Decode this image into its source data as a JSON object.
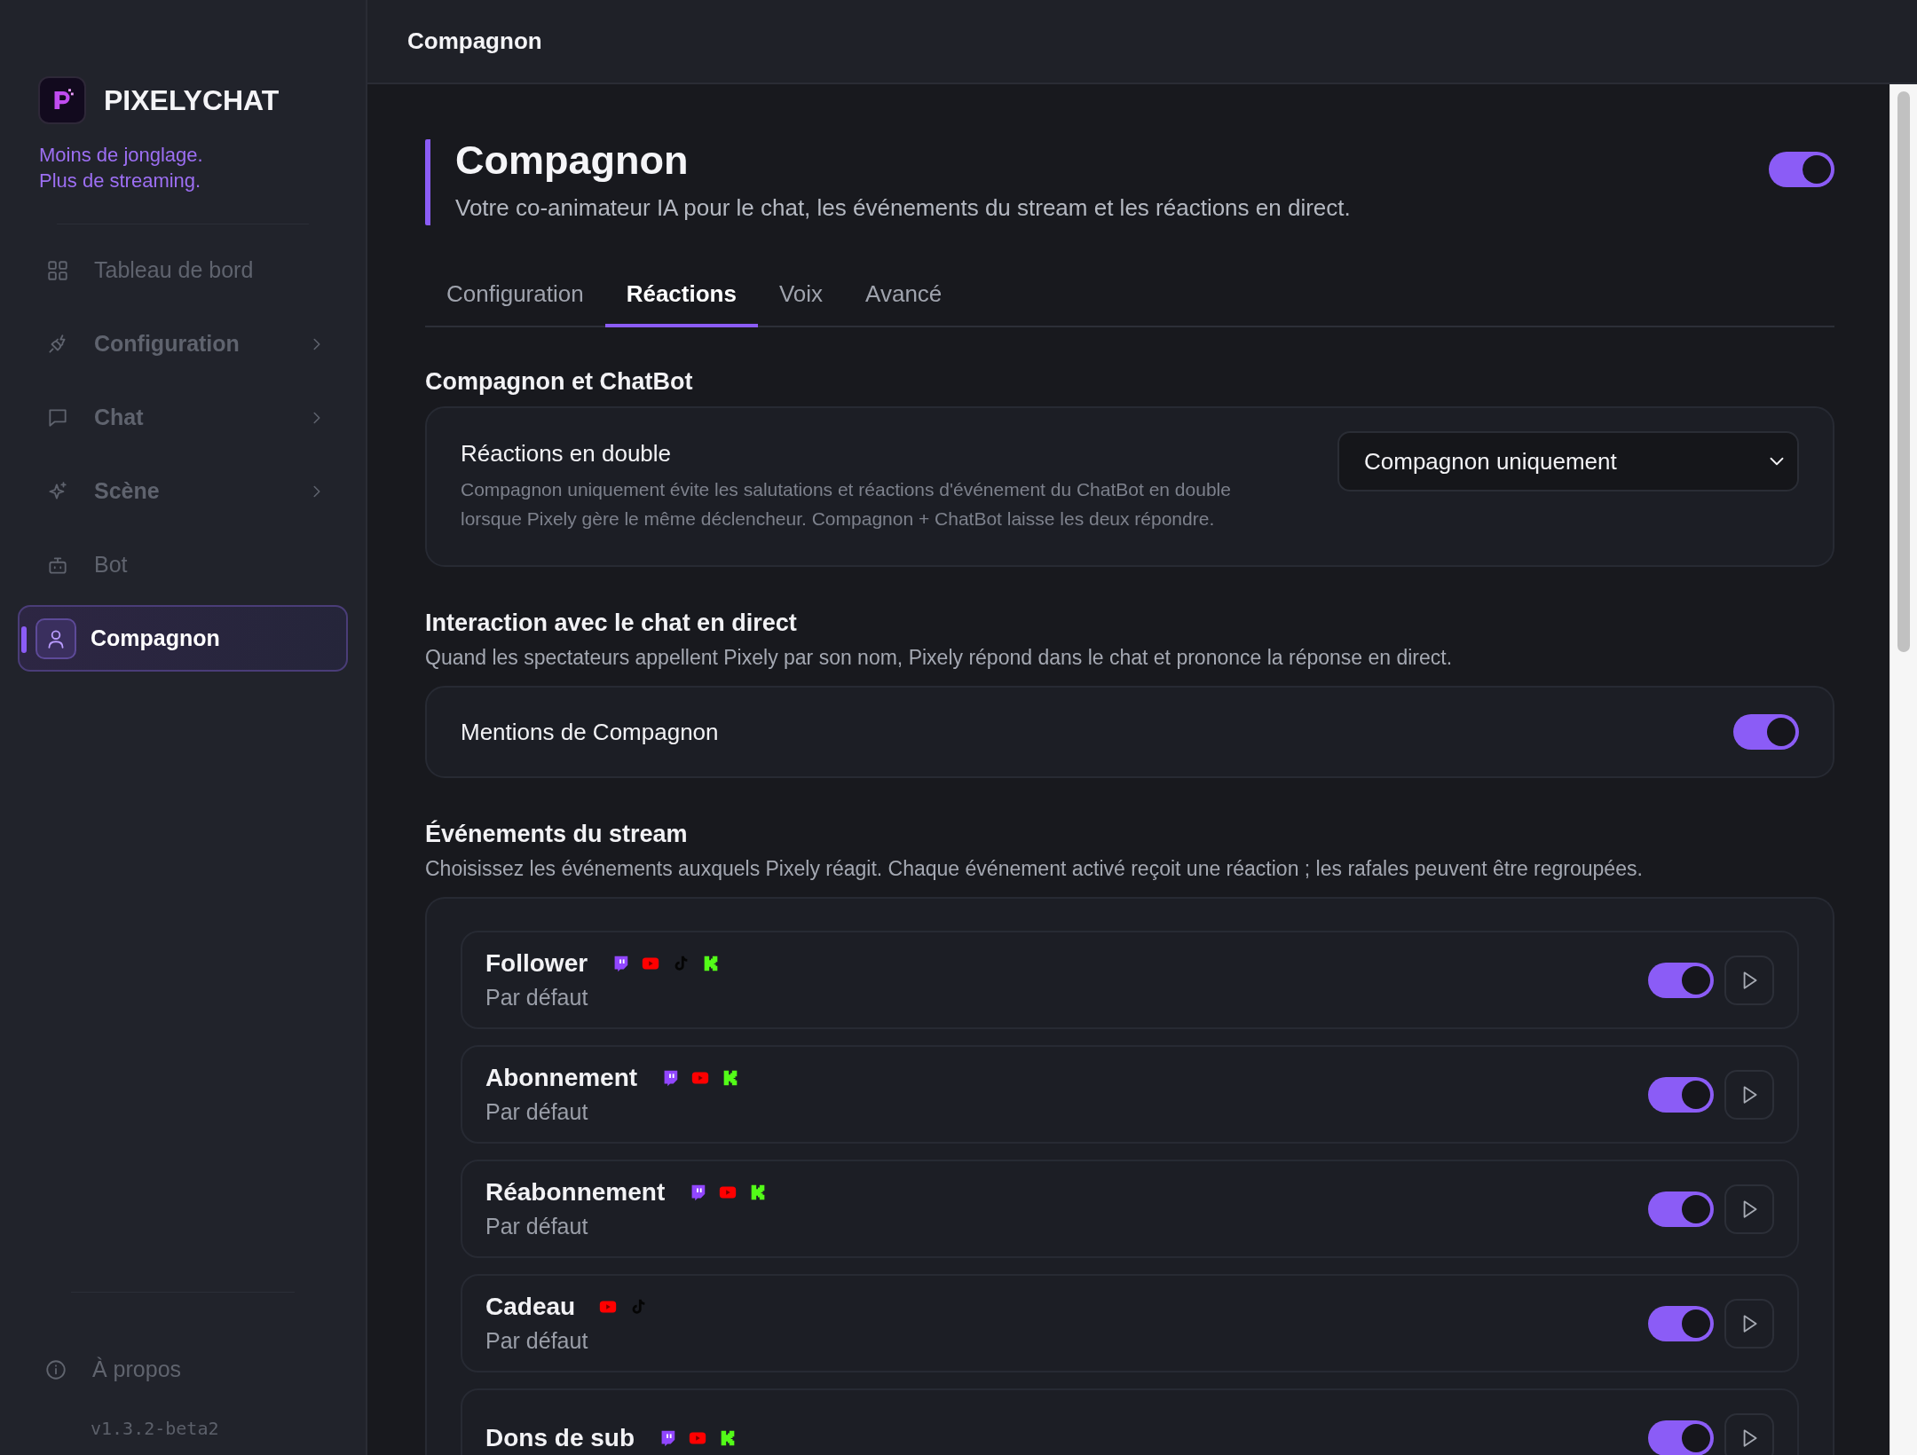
{
  "app": {
    "name": "PIXELYCHAT",
    "tagline": [
      "Moins de jonglage.",
      "Plus de streaming."
    ]
  },
  "nav": [
    {
      "label": "Tableau de bord",
      "has_submenu": false,
      "selected": false
    },
    {
      "label": "Configuration",
      "has_submenu": true,
      "selected": false
    },
    {
      "label": "Chat",
      "has_submenu": true,
      "selected": false
    },
    {
      "label": "Scène",
      "has_submenu": true,
      "selected": false
    },
    {
      "label": "Bot",
      "has_submenu": false,
      "selected": false
    },
    {
      "label": "Compagnon",
      "has_submenu": false,
      "selected": true
    }
  ],
  "about": {
    "label": "À propos"
  },
  "version": "v1.3.2-beta2",
  "topbar": {
    "title": "Compagnon"
  },
  "header": {
    "title": "Compagnon",
    "subtitle": "Votre co-animateur IA pour le chat, les événements du stream et les réactions en direct.",
    "enabled": true
  },
  "tabs": [
    {
      "label": "Configuration",
      "selected": false
    },
    {
      "label": "Réactions",
      "selected": true
    },
    {
      "label": "Voix",
      "selected": false
    },
    {
      "label": "Avancé",
      "selected": false
    }
  ],
  "sections": [
    {
      "kind": "select",
      "title": "Compagnon et ChatBot",
      "setting": {
        "label": "Réactions en double",
        "description": "Compagnon uniquement évite les salutations et réactions d'événement du ChatBot en double lorsque Pixely gère le même déclencheur. Compagnon + ChatBot laisse les deux répondre.",
        "value": "Compagnon uniquement"
      }
    },
    {
      "kind": "toggle",
      "title": "Interaction avec le chat en direct",
      "description": "Quand les spectateurs appellent Pixely par son nom, Pixely répond dans le chat et prononce la réponse en direct.",
      "setting": {
        "label": "Mentions de Compagnon",
        "on": true
      }
    },
    {
      "kind": "events",
      "title": "Événements du stream",
      "description": "Choisissez les événements auxquels Pixely réagit. Chaque événement activé reçoit une réaction ; les rafales peuvent être regroupées.",
      "events": [
        {
          "name": "Follower",
          "platforms": [
            {
              "kind": "twitch"
            },
            {
              "kind": "youtube"
            },
            {
              "kind": "tiktok"
            },
            {
              "kind": "kick"
            }
          ],
          "preset": "Par défaut",
          "on": true
        },
        {
          "name": "Abonnement",
          "platforms": [
            {
              "kind": "twitch"
            },
            {
              "kind": "youtube"
            },
            {
              "kind": "kick"
            }
          ],
          "preset": "Par défaut",
          "on": true
        },
        {
          "name": "Réabonnement",
          "platforms": [
            {
              "kind": "twitch"
            },
            {
              "kind": "youtube"
            },
            {
              "kind": "kick"
            }
          ],
          "preset": "Par défaut",
          "on": true
        },
        {
          "name": "Cadeau",
          "platforms": [
            {
              "kind": "youtube"
            },
            {
              "kind": "tiktok"
            }
          ],
          "preset": "Par défaut",
          "on": true
        },
        {
          "name": "Dons de sub",
          "platforms": [
            {
              "kind": "twitch"
            },
            {
              "kind": "youtube"
            },
            {
              "kind": "kick"
            }
          ],
          "on": true
        }
      ]
    }
  ]
}
